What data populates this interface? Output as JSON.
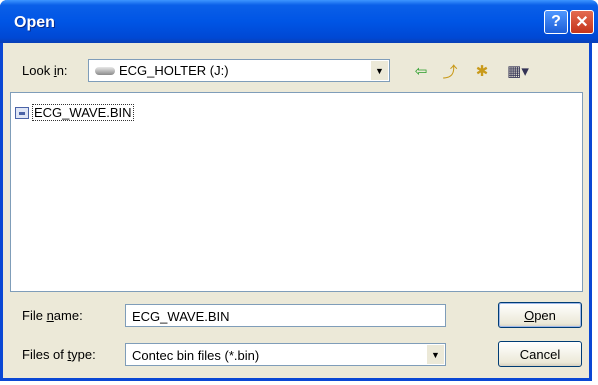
{
  "window": {
    "title": "Open",
    "help_glyph": "?",
    "close_glyph": "✕"
  },
  "toolbar": {
    "lookin_label_pre": "Look ",
    "lookin_label_accel": "i",
    "lookin_label_post": "n:",
    "lookin_value": "ECG_HOLTER (J:)",
    "lookin_icon": "drive-icon",
    "back_glyph": "⇦",
    "up_glyph": "⤴",
    "new_folder_glyph": "✱",
    "views_glyph": "▦▾"
  },
  "files": [
    {
      "name": "ECG_WAVE.BIN",
      "icon": "bin-file-icon"
    }
  ],
  "filename": {
    "label_pre": "File ",
    "label_accel": "n",
    "label_post": "ame:",
    "value": "ECG_WAVE.BIN"
  },
  "filetype": {
    "label_pre": "Files of ",
    "label_accel": "t",
    "label_post": "ype:",
    "value": "Contec bin files (*.bin)"
  },
  "buttons": {
    "open_accel": "O",
    "open_rest": "pen",
    "cancel": "Cancel"
  },
  "colors": {
    "titlebar": "#0055e5",
    "face": "#ece9d8",
    "border": "#7f9db9"
  }
}
